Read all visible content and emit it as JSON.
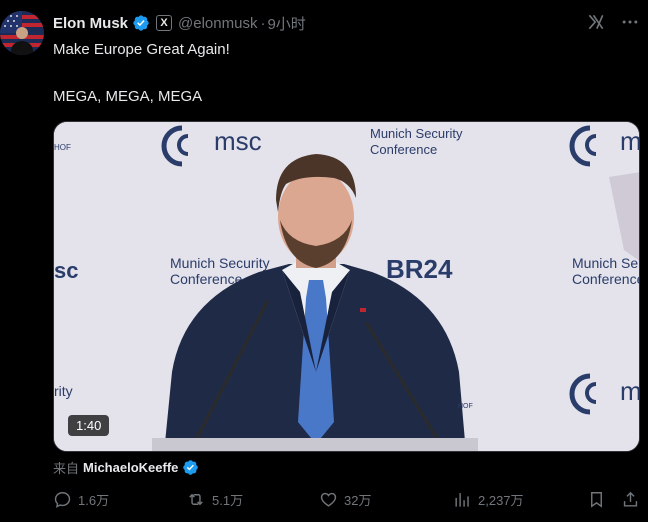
{
  "tweet": {
    "author_name": "Elon Musk",
    "handle": "@elonmusk",
    "separator": "·",
    "time": "9小时",
    "x_badge": "X",
    "text_line1": "Make Europe Great Again!",
    "text_line2": "MEGA, MEGA, MEGA"
  },
  "media": {
    "duration": "1:40",
    "slogan_left_top": "msc",
    "msc_top_center": "msc",
    "msc_top_right": "m",
    "msc_left_mid": "sc",
    "msc_bottom_right": "m",
    "conference_line1": "Munich Security",
    "conference_line2": "Conference",
    "conference_mid_line1": "Munich Security",
    "conference_mid_line2": "Conference",
    "conference_right_line1": "Munich Se",
    "conference_right_line2": "Conference",
    "br24": "BR24",
    "left_edge_top": "HOF",
    "left_edge_bottom": "rity",
    "podium_tag": "HOF"
  },
  "attribution": {
    "from_label": "来自",
    "source_name": "MichaeloKeeffe"
  },
  "actions": {
    "replies": "1.6万",
    "reposts": "5.1万",
    "likes": "32万",
    "views": "2,237万"
  },
  "colors": {
    "background": "#000000",
    "text_primary": "#e7e9ea",
    "text_secondary": "#71767b",
    "verified_blue": "#1d9bf0"
  },
  "icons": [
    "verified-icon",
    "x-badge-icon",
    "grok-icon",
    "more-icon",
    "reply-icon",
    "repost-icon",
    "like-icon",
    "views-icon",
    "bookmark-icon",
    "share-icon"
  ]
}
